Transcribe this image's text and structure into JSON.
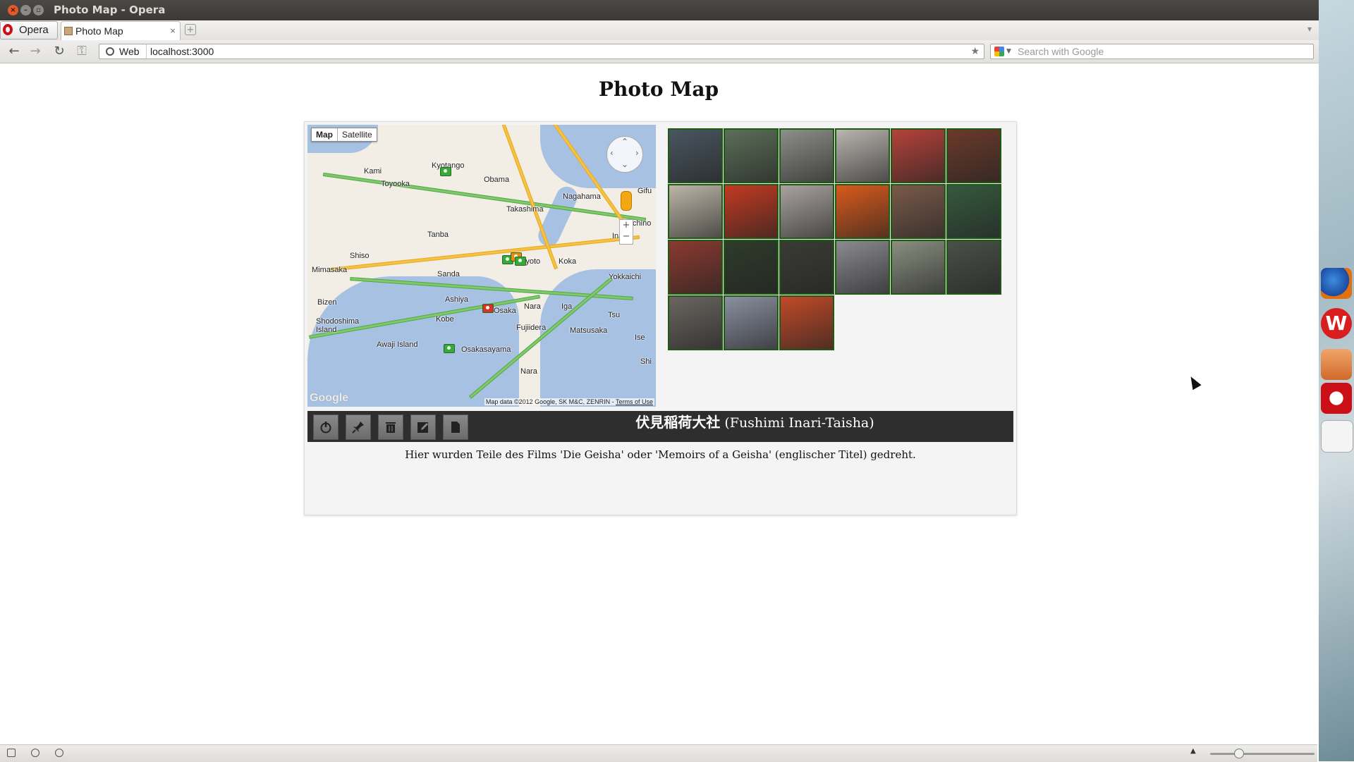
{
  "window": {
    "title": "Photo Map - Opera"
  },
  "browser": {
    "menu_label": "Opera",
    "tab": {
      "title": "Photo Map",
      "close": "×"
    },
    "new_tab": "+",
    "address": {
      "mode_label": "Web",
      "url": "localhost:3000"
    },
    "search": {
      "placeholder": "Search with Google"
    }
  },
  "page": {
    "title": "Photo Map",
    "map": {
      "type_buttons": [
        "Map",
        "Satellite"
      ],
      "active_type": "Map",
      "labels": [
        "Kami",
        "Kyotango",
        "Toyooka",
        "Obama",
        "Gifu",
        "Nagahama",
        "Takashima",
        "Tanba",
        "Ichino",
        "Ina",
        "Shiso",
        "Mimasaka",
        "Sanda",
        "Koka",
        "Yokkaichi",
        "Ashiya",
        "Bizen",
        "Osaka",
        "Nara",
        "Iga",
        "Kobe",
        "Fujiidera",
        "Matsusaka",
        "Tsu",
        "Shodoshima Island",
        "Awaji Island",
        "Osakasayama",
        "Ise",
        "Shi",
        "Nara",
        "Kyoto"
      ],
      "attribution": "Map data ©2012 Google, SK M&C, ZENRIN -",
      "terms_link": "Terms of Use",
      "logo": "Google"
    },
    "gallery": {
      "photo_count": 21,
      "colors": [
        "#4a5660",
        "#5b6f58",
        "#8d8f8a",
        "#b9b5b0",
        "#b5423a",
        "#6b3a2a",
        "#bdb6a8",
        "#c23a22",
        "#a9a3a0",
        "#d95a1c",
        "#7a5a4a",
        "#355a3e",
        "#8a3a30",
        "#2e3b2a",
        "#3b3b35",
        "#8a8a90",
        "#8a8f80",
        "#4a5048",
        "#6a6560",
        "#8a90a0",
        "#c24a28"
      ]
    },
    "toolbar": {
      "buttons": [
        "power",
        "pin",
        "delete",
        "edit",
        "document"
      ]
    },
    "photo": {
      "title_jp": "伏見稲荷大社",
      "title_romaji": "(Fushimi Inari-Taisha)",
      "description": "Hier wurden Teile des Films 'Die Geisha' oder 'Memoirs of a Geisha' (englischer Titel) gedreht."
    }
  },
  "launcher": {
    "icons": [
      "firefox-icon",
      "wikipedia-icon",
      "home-folder-icon",
      "opera-icon",
      "document-icon"
    ]
  }
}
